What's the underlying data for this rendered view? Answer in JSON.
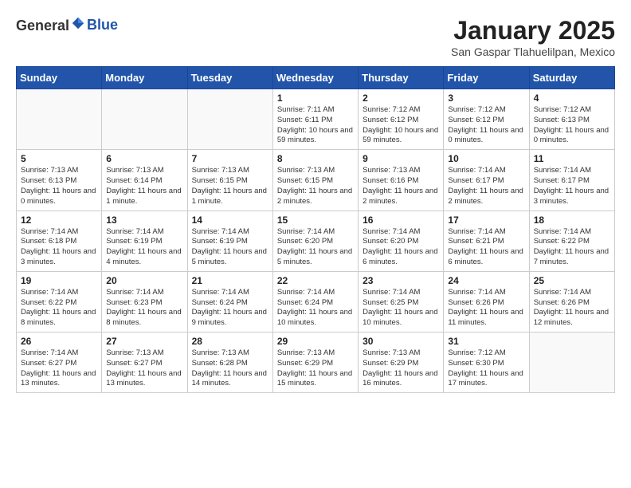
{
  "header": {
    "logo_general": "General",
    "logo_blue": "Blue",
    "month": "January 2025",
    "location": "San Gaspar Tlahuelilpan, Mexico"
  },
  "days_of_week": [
    "Sunday",
    "Monday",
    "Tuesday",
    "Wednesday",
    "Thursday",
    "Friday",
    "Saturday"
  ],
  "weeks": [
    [
      {
        "day": "",
        "empty": true
      },
      {
        "day": "",
        "empty": true
      },
      {
        "day": "",
        "empty": true
      },
      {
        "day": "1",
        "sunrise": "7:11 AM",
        "sunset": "6:11 PM",
        "daylight": "10 hours and 59 minutes."
      },
      {
        "day": "2",
        "sunrise": "7:12 AM",
        "sunset": "6:12 PM",
        "daylight": "10 hours and 59 minutes."
      },
      {
        "day": "3",
        "sunrise": "7:12 AM",
        "sunset": "6:12 PM",
        "daylight": "11 hours and 0 minutes."
      },
      {
        "day": "4",
        "sunrise": "7:12 AM",
        "sunset": "6:13 PM",
        "daylight": "11 hours and 0 minutes."
      }
    ],
    [
      {
        "day": "5",
        "sunrise": "7:13 AM",
        "sunset": "6:13 PM",
        "daylight": "11 hours and 0 minutes."
      },
      {
        "day": "6",
        "sunrise": "7:13 AM",
        "sunset": "6:14 PM",
        "daylight": "11 hours and 1 minute."
      },
      {
        "day": "7",
        "sunrise": "7:13 AM",
        "sunset": "6:15 PM",
        "daylight": "11 hours and 1 minute."
      },
      {
        "day": "8",
        "sunrise": "7:13 AM",
        "sunset": "6:15 PM",
        "daylight": "11 hours and 2 minutes."
      },
      {
        "day": "9",
        "sunrise": "7:13 AM",
        "sunset": "6:16 PM",
        "daylight": "11 hours and 2 minutes."
      },
      {
        "day": "10",
        "sunrise": "7:14 AM",
        "sunset": "6:17 PM",
        "daylight": "11 hours and 2 minutes."
      },
      {
        "day": "11",
        "sunrise": "7:14 AM",
        "sunset": "6:17 PM",
        "daylight": "11 hours and 3 minutes."
      }
    ],
    [
      {
        "day": "12",
        "sunrise": "7:14 AM",
        "sunset": "6:18 PM",
        "daylight": "11 hours and 3 minutes."
      },
      {
        "day": "13",
        "sunrise": "7:14 AM",
        "sunset": "6:19 PM",
        "daylight": "11 hours and 4 minutes."
      },
      {
        "day": "14",
        "sunrise": "7:14 AM",
        "sunset": "6:19 PM",
        "daylight": "11 hours and 5 minutes."
      },
      {
        "day": "15",
        "sunrise": "7:14 AM",
        "sunset": "6:20 PM",
        "daylight": "11 hours and 5 minutes."
      },
      {
        "day": "16",
        "sunrise": "7:14 AM",
        "sunset": "6:20 PM",
        "daylight": "11 hours and 6 minutes."
      },
      {
        "day": "17",
        "sunrise": "7:14 AM",
        "sunset": "6:21 PM",
        "daylight": "11 hours and 6 minutes."
      },
      {
        "day": "18",
        "sunrise": "7:14 AM",
        "sunset": "6:22 PM",
        "daylight": "11 hours and 7 minutes."
      }
    ],
    [
      {
        "day": "19",
        "sunrise": "7:14 AM",
        "sunset": "6:22 PM",
        "daylight": "11 hours and 8 minutes."
      },
      {
        "day": "20",
        "sunrise": "7:14 AM",
        "sunset": "6:23 PM",
        "daylight": "11 hours and 8 minutes."
      },
      {
        "day": "21",
        "sunrise": "7:14 AM",
        "sunset": "6:24 PM",
        "daylight": "11 hours and 9 minutes."
      },
      {
        "day": "22",
        "sunrise": "7:14 AM",
        "sunset": "6:24 PM",
        "daylight": "11 hours and 10 minutes."
      },
      {
        "day": "23",
        "sunrise": "7:14 AM",
        "sunset": "6:25 PM",
        "daylight": "11 hours and 10 minutes."
      },
      {
        "day": "24",
        "sunrise": "7:14 AM",
        "sunset": "6:26 PM",
        "daylight": "11 hours and 11 minutes."
      },
      {
        "day": "25",
        "sunrise": "7:14 AM",
        "sunset": "6:26 PM",
        "daylight": "11 hours and 12 minutes."
      }
    ],
    [
      {
        "day": "26",
        "sunrise": "7:14 AM",
        "sunset": "6:27 PM",
        "daylight": "11 hours and 13 minutes."
      },
      {
        "day": "27",
        "sunrise": "7:13 AM",
        "sunset": "6:27 PM",
        "daylight": "11 hours and 13 minutes."
      },
      {
        "day": "28",
        "sunrise": "7:13 AM",
        "sunset": "6:28 PM",
        "daylight": "11 hours and 14 minutes."
      },
      {
        "day": "29",
        "sunrise": "7:13 AM",
        "sunset": "6:29 PM",
        "daylight": "11 hours and 15 minutes."
      },
      {
        "day": "30",
        "sunrise": "7:13 AM",
        "sunset": "6:29 PM",
        "daylight": "11 hours and 16 minutes."
      },
      {
        "day": "31",
        "sunrise": "7:12 AM",
        "sunset": "6:30 PM",
        "daylight": "11 hours and 17 minutes."
      },
      {
        "day": "",
        "empty": true
      }
    ]
  ],
  "labels": {
    "sunrise": "Sunrise:",
    "sunset": "Sunset:",
    "daylight": "Daylight:"
  }
}
